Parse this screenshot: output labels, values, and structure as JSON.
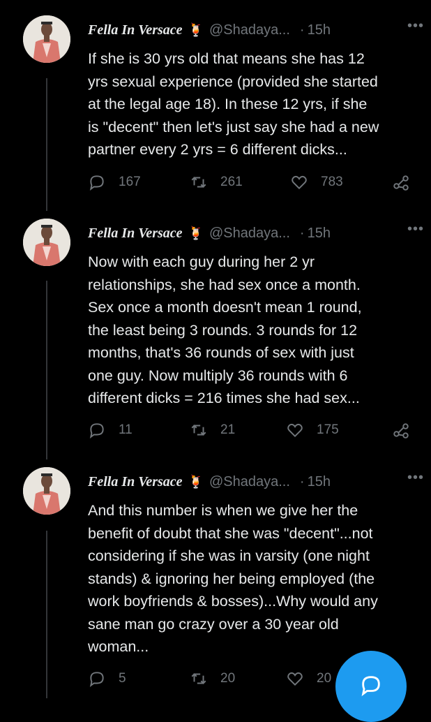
{
  "tweets": [
    {
      "author": {
        "name": "Fella In Versace",
        "emoji": "🍹",
        "handle": "@Shadaya...",
        "time": "15h"
      },
      "body_lines": [
        "If she is 30 yrs old that means she has 12",
        "yrs sexual experience (provided she started",
        "at the legal age 18). In these 12 yrs, if she",
        "is \"decent\" then let's just say she had a new",
        "partner every 2 yrs = 6 different dicks..."
      ],
      "stats": {
        "replies": "167",
        "retweets": "261",
        "likes": "783"
      }
    },
    {
      "author": {
        "name": "Fella In Versace",
        "emoji": "🍹",
        "handle": "@Shadaya...",
        "time": "15h"
      },
      "body_lines": [
        "Now with each guy during her 2 yr",
        "relationships, she had sex once a month.",
        "Sex once a month doesn't mean 1 round,",
        "the least being 3 rounds. 3 rounds for 12",
        "months, that's 36 rounds of sex with just",
        "one guy. Now multiply 36 rounds with 6",
        "different dicks = 216 times she had sex..."
      ],
      "stats": {
        "replies": "11",
        "retweets": "21",
        "likes": "175"
      }
    },
    {
      "author": {
        "name": "Fella In Versace",
        "emoji": "🍹",
        "handle": "@Shadaya...",
        "time": "15h"
      },
      "body_lines": [
        "And this number is when we give her the",
        "benefit of doubt that she was \"decent\"...not",
        "considering if she was in varsity (one night",
        "stands) & ignoring her being employed (the",
        "work boyfriends & bosses)...Why would any",
        "sane man go crazy over a 30 year old",
        "woman..."
      ],
      "stats": {
        "replies": "5",
        "retweets": "20",
        "likes": "20"
      }
    }
  ],
  "ui": {
    "dot": "·",
    "more": "•••"
  },
  "colors": {
    "background": "#000000",
    "text": "#e7e9ea",
    "muted": "#71767b",
    "accent": "#1d9bf0"
  },
  "icons": {
    "reply": "reply-icon",
    "retweet": "retweet-icon",
    "like": "heart-icon",
    "share": "share-icon",
    "compose": "compose-icon"
  }
}
